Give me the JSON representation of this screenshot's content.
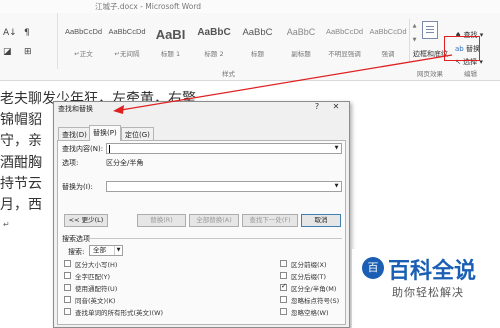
{
  "window": {
    "title": "江城子.docx - Microsoft Word"
  },
  "ribbon": {
    "styles": [
      {
        "sample": "AaBbCcDd",
        "name": "↵正文",
        "size": 7.5,
        "color": "#555555",
        "bold": false
      },
      {
        "sample": "AaBbCcDd",
        "name": "↵无间隔",
        "size": 7.5,
        "color": "#555555",
        "bold": false
      },
      {
        "sample": "AaBI",
        "name": "标题 1",
        "size": 13,
        "color": "#555555",
        "bold": true
      },
      {
        "sample": "AaBbC",
        "name": "标题 2",
        "size": 10,
        "color": "#555555",
        "bold": true
      },
      {
        "sample": "AaBbC",
        "name": "标题",
        "size": 9.5,
        "color": "#555555",
        "bold": false
      },
      {
        "sample": "AaBbC",
        "name": "副标题",
        "size": 9,
        "color": "#888888",
        "bold": false
      },
      {
        "sample": "AaBbCcDd",
        "name": "不明显强调",
        "size": 7.5,
        "color": "#888888",
        "bold": false
      },
      {
        "sample": "AaBbCcDd",
        "name": "强调",
        "size": 7.5,
        "color": "#888888",
        "bold": false
      }
    ],
    "styles_group_label": "样式",
    "find_label": "查找",
    "replace_label": "替换",
    "select_label": "选择",
    "edit_group_label": "编辑",
    "word_label": "边框和底纹",
    "page_effects_label": "网页效果"
  },
  "document": {
    "lines": [
      "老夫聊发少年狂，左牵黄，右擎",
      "锦帽貂",
      "守，亲",
      "酒酣胸",
      "持节云",
      "月，西"
    ]
  },
  "dialog": {
    "title": "查找和替换",
    "help": "?",
    "close": "✕",
    "tabs": [
      "查找(D)",
      "替换(P)",
      "定位(G)"
    ],
    "active_tab": 1,
    "find_label": "查找内容(N):",
    "find_value": "",
    "options_label": "选项:",
    "options_value": "区分全/半角",
    "replace_label": "替换为(I):",
    "replace_value": "",
    "buttons": {
      "less": "<< 更少(L)",
      "replace": "替换(R)",
      "replace_all": "全部替换(A)",
      "find_next": "查找下一处(F)",
      "cancel": "取消"
    },
    "search_options_title": "搜索选项",
    "search_label": "搜索:",
    "search_value": "全部",
    "left_options": [
      {
        "label": "区分大小写(H)",
        "checked": false
      },
      {
        "label": "全字匹配(Y)",
        "checked": false
      },
      {
        "label": "使用通配符(U)",
        "checked": false
      },
      {
        "label": "同音(英文)(K)",
        "checked": false
      },
      {
        "label": "查找单词的所有形式(英文)(W)",
        "checked": false
      }
    ],
    "right_options": [
      {
        "label": "区分前缀(X)",
        "checked": false
      },
      {
        "label": "区分后缀(T)",
        "checked": false
      },
      {
        "label": "区分全/半角(M)",
        "checked": true
      },
      {
        "label": "忽略标点符号(S)",
        "checked": false
      },
      {
        "label": "忽略空格(W)",
        "checked": false
      }
    ]
  },
  "watermark": {
    "logo": "百",
    "title": "百科全说",
    "subtitle": "助你轻松解决"
  },
  "colors": {
    "annotation_red": "#e02020",
    "brand_blue": "#1a5fb4"
  }
}
